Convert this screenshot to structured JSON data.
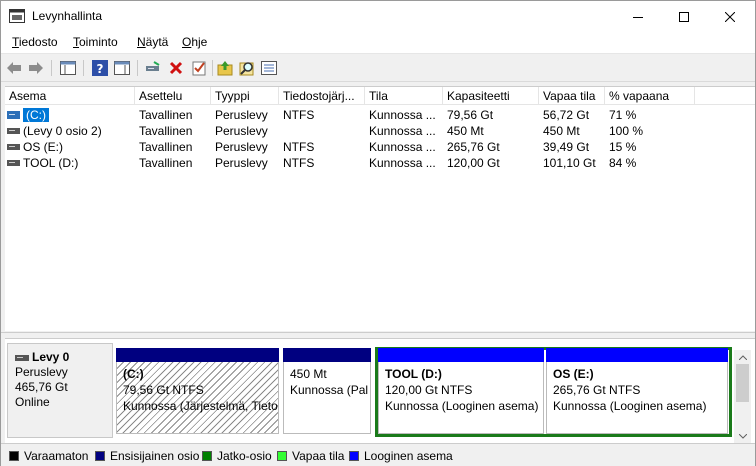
{
  "window": {
    "title": "Levynhallinta",
    "icon": "disk-management-icon"
  },
  "menu": [
    "Tiedosto",
    "Toiminto",
    "Näytä",
    "Ohje"
  ],
  "toolbar": {
    "icons": [
      "back-arrow-icon",
      "forward-arrow-icon",
      "show-hide-console-tree-icon",
      "help-icon",
      "properties-pane-icon",
      "connect-drive-icon",
      "delete-icon",
      "check-properties-icon",
      "open-folder-icon",
      "search-icon",
      "view-icon"
    ]
  },
  "volumes": {
    "columns": [
      "Asema",
      "Asettelu",
      "Tyyppi",
      "Tiedostojärj...",
      "Tila",
      "Kapasiteetti",
      "Vapaa tila",
      "% vapaana"
    ],
    "rows": [
      {
        "name": "(C:)",
        "layout": "Tavallinen",
        "type": "Peruslevy",
        "fs": "NTFS",
        "status": "Kunnossa ...",
        "capacity": "79,56 Gt",
        "free": "56,72 Gt",
        "pct": "71 %",
        "selected": true,
        "icon": "system-drive-icon"
      },
      {
        "name": "(Levy 0 osio 2)",
        "layout": "Tavallinen",
        "type": "Peruslevy",
        "fs": "",
        "status": "Kunnossa ...",
        "capacity": "450 Mt",
        "free": "450 Mt",
        "pct": "100 %",
        "selected": false,
        "icon": "drive-icon"
      },
      {
        "name": "OS (E:)",
        "layout": "Tavallinen",
        "type": "Peruslevy",
        "fs": "NTFS",
        "status": "Kunnossa ...",
        "capacity": "265,76 Gt",
        "free": "39,49 Gt",
        "pct": "15 %",
        "selected": false,
        "icon": "drive-icon"
      },
      {
        "name": "TOOL (D:)",
        "layout": "Tavallinen",
        "type": "Peruslevy",
        "fs": "NTFS",
        "status": "Kunnossa ...",
        "capacity": "120,00 Gt",
        "free": "101,10 Gt",
        "pct": "84 %",
        "selected": false,
        "icon": "drive-icon"
      }
    ]
  },
  "disk": {
    "name": "Levy 0",
    "type": "Peruslevy",
    "size": "465,76 Gt",
    "state": "Online",
    "partitions": [
      {
        "name": "(C:)",
        "size": "79,56 Gt NTFS",
        "status": "Kunnossa (Järjestelmä, Tietol",
        "kind": "primary",
        "selected": true
      },
      {
        "name": "",
        "size": "450 Mt",
        "status": "Kunnossa (Pal",
        "kind": "primary",
        "selected": false
      },
      {
        "name": "TOOL  (D:)",
        "size": "120,00 Gt NTFS",
        "status": "Kunnossa (Looginen asema)",
        "kind": "logical",
        "selected": false
      },
      {
        "name": "OS  (E:)",
        "size": "265,76 Gt NTFS",
        "status": "Kunnossa (Looginen asema)",
        "kind": "logical",
        "selected": false
      }
    ]
  },
  "legend": [
    {
      "label": "Varaamaton",
      "color": "#000000"
    },
    {
      "label": "Ensisijainen osio",
      "color": "#000080"
    },
    {
      "label": "Jatko-osio",
      "color": "#008000"
    },
    {
      "label": "Vapaa tila",
      "color": "#33ff33"
    },
    {
      "label": "Looginen asema",
      "color": "#0000ff"
    }
  ],
  "colors": {
    "primary": "#000080",
    "logical": "#0000ff",
    "extended": "#1a7a1a",
    "selection": "#0078d7"
  }
}
